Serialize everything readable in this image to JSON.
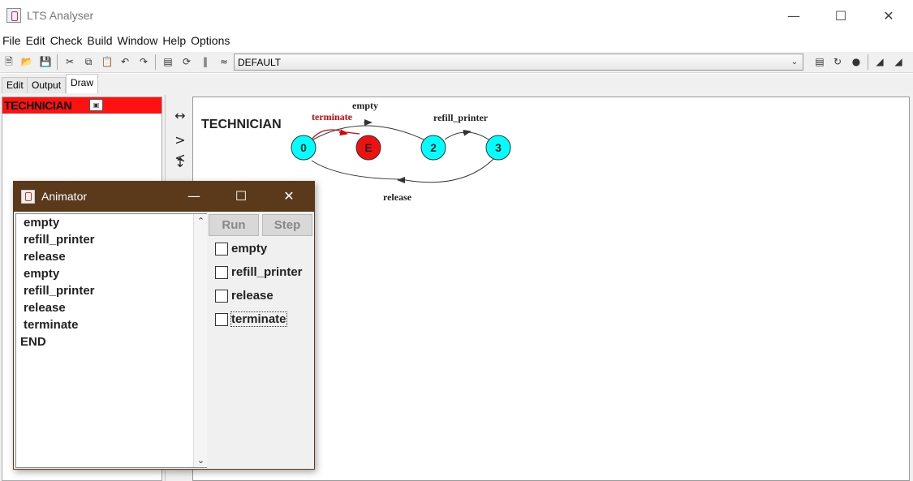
{
  "window": {
    "title": "LTS Analyser"
  },
  "menu": [
    "File",
    "Edit",
    "Check",
    "Build",
    "Window",
    "Help",
    "Options"
  ],
  "toolbar": {
    "target_selected": "DEFAULT"
  },
  "tabs": [
    {
      "label": "Edit",
      "active": false
    },
    {
      "label": "Output",
      "active": false
    },
    {
      "label": "Draw",
      "active": true
    }
  ],
  "process_list": {
    "items": [
      {
        "label": "TECHNICIAN",
        "selected": true,
        "color": "#ff1111"
      }
    ]
  },
  "diagram": {
    "process_name": "TECHNICIAN",
    "states": [
      {
        "id": "0",
        "color": "#00ffff"
      },
      {
        "id": "E",
        "color": "#ee1111"
      },
      {
        "id": "2",
        "color": "#00ffff"
      },
      {
        "id": "3",
        "color": "#00ffff"
      }
    ],
    "transitions": [
      {
        "from": "0",
        "to": "E",
        "label": "terminate",
        "color": "#dd0000"
      },
      {
        "from": "0",
        "to": "2",
        "label": "empty",
        "color": "#333333"
      },
      {
        "from": "2",
        "to": "3",
        "label": "refill_printer",
        "color": "#333333"
      },
      {
        "from": "3",
        "to": "0",
        "label": "release",
        "color": "#333333"
      }
    ]
  },
  "animator": {
    "title": "Animator",
    "trace": [
      "empty",
      "refill_printer",
      "release",
      "empty",
      "refill_printer",
      "release",
      "terminate",
      "END"
    ],
    "buttons": {
      "run": "Run",
      "step": "Step"
    },
    "actions": [
      {
        "label": "empty",
        "checked": false
      },
      {
        "label": "refill_printer",
        "checked": false
      },
      {
        "label": "release",
        "checked": false
      },
      {
        "label": "terminate",
        "checked": false,
        "focused": true
      }
    ]
  }
}
